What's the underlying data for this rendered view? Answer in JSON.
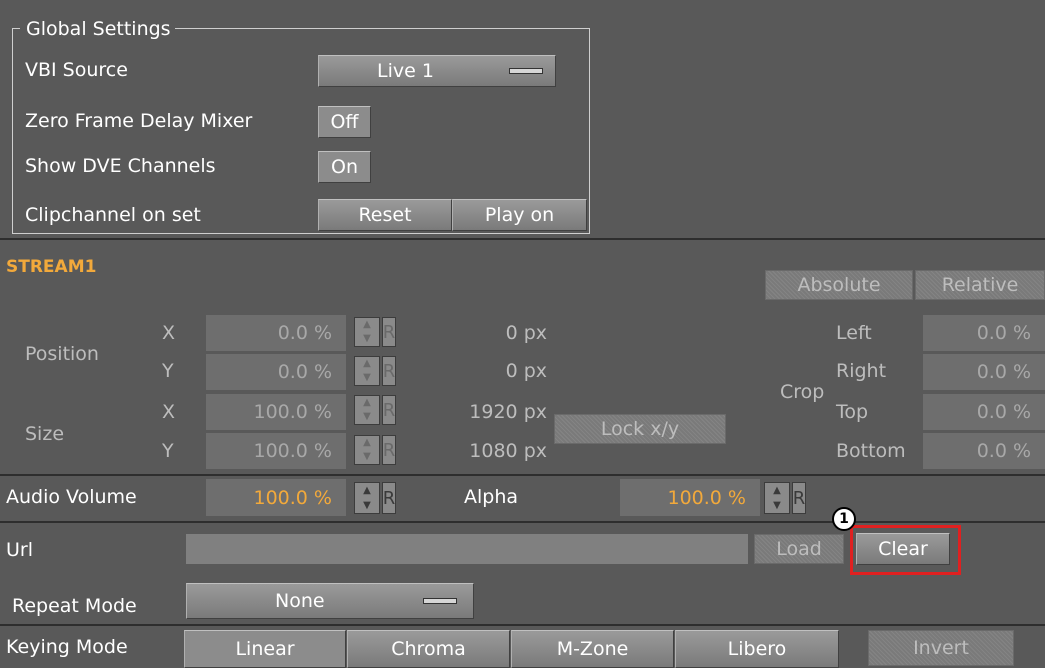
{
  "global_settings": {
    "title": "Global Settings",
    "vbi_source_label": "VBI Source",
    "vbi_source_value": "Live 1",
    "zero_frame_label": "Zero Frame Delay Mixer",
    "zero_frame_value": "Off",
    "show_dve_label": "Show DVE Channels",
    "show_dve_value": "On",
    "clipchannel_label": "Clipchannel on set",
    "reset_label": "Reset",
    "play_on_label": "Play on"
  },
  "stream": {
    "title": "STREAM1",
    "absolute_label": "Absolute",
    "relative_label": "Relative",
    "position_label": "Position",
    "size_label": "Size",
    "x_label": "X",
    "y_label": "Y",
    "r_label": "R",
    "position_x_value": "0.0 %",
    "position_y_value": "0.0 %",
    "size_x_value": "100.0 %",
    "size_y_value": "100.0 %",
    "position_x_px": "0 px",
    "position_y_px": "0 px",
    "size_x_px": "1920 px",
    "size_y_px": "1080 px",
    "lock_xy_label": "Lock x/y",
    "crop_label": "Crop",
    "crop_left_label": "Left",
    "crop_right_label": "Right",
    "crop_top_label": "Top",
    "crop_bottom_label": "Bottom",
    "crop_left_value": "0.0 %",
    "crop_right_value": "0.0 %",
    "crop_top_value": "0.0 %",
    "crop_bottom_value": "0.0 %"
  },
  "audio": {
    "volume_label": "Audio Volume",
    "volume_value": "100.0 %",
    "alpha_label": "Alpha",
    "alpha_value": "100.0 %"
  },
  "url": {
    "label": "Url",
    "value": "",
    "load_label": "Load",
    "clear_label": "Clear",
    "callout_number": "1",
    "repeat_label": "Repeat Mode",
    "repeat_value": "None"
  },
  "keying": {
    "label": "Keying Mode",
    "linear": "Linear",
    "chroma": "Chroma",
    "mzone": "M-Zone",
    "libero": "Libero",
    "invert": "Invert"
  },
  "colors": {
    "background": "#595959",
    "accent_orange": "#f2a93b",
    "highlight_red": "#e02020"
  }
}
